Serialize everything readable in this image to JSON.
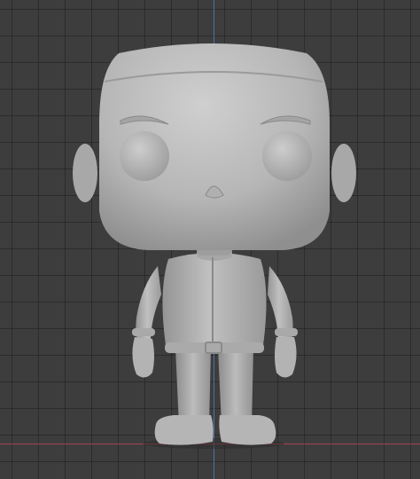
{
  "viewport": {
    "kind": "3D viewport",
    "background_color": "#3d3d3d",
    "grid_color": "#2e2e2e",
    "axis_x_color": "#a8434f",
    "axis_y_color": "#4f6fa8"
  },
  "model": {
    "kind": "sculpted figure",
    "base_color": "#b8b8b8",
    "shadow_color": "#8e8e8e",
    "highlight_color": "#d2d2d2"
  }
}
